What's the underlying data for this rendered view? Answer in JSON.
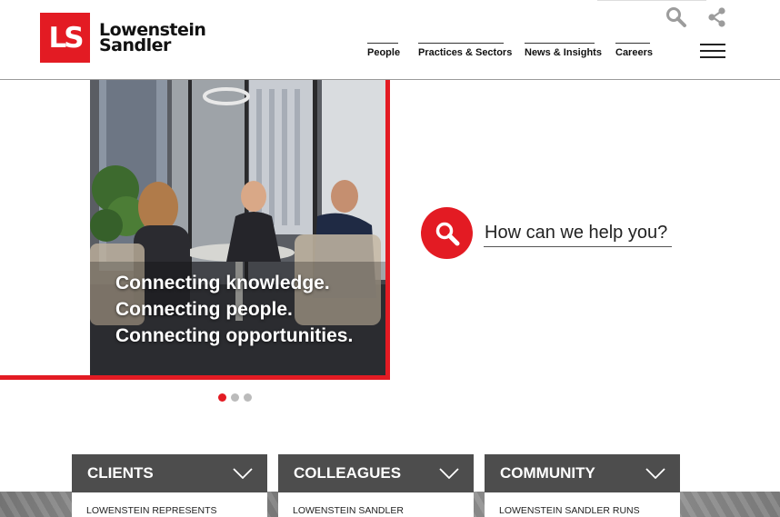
{
  "brand": {
    "logo_mark": "LS",
    "name_line1": "Lowenstein",
    "name_line2": "Sandler",
    "accent_color": "#e31b23"
  },
  "header": {
    "nav": [
      {
        "label": "People"
      },
      {
        "label": "Practices & Sectors"
      },
      {
        "label": "News & Insights"
      },
      {
        "label": "Careers"
      }
    ],
    "icons": [
      "search-icon",
      "share-icon",
      "hamburger-menu-icon"
    ]
  },
  "hero": {
    "lines": [
      "Connecting knowledge.",
      "Connecting people.",
      "Connecting opportunities."
    ],
    "slides_total": 3,
    "active_slide": 1
  },
  "search": {
    "placeholder": "How can we help you?"
  },
  "cards": [
    {
      "title": "CLIENTS",
      "subtitle": "LOWENSTEIN REPRESENTS"
    },
    {
      "title": "COLLEAGUES",
      "subtitle": "LOWENSTEIN SANDLER"
    },
    {
      "title": "COMMUNITY",
      "subtitle": "LOWENSTEIN SANDLER RUNS"
    }
  ]
}
